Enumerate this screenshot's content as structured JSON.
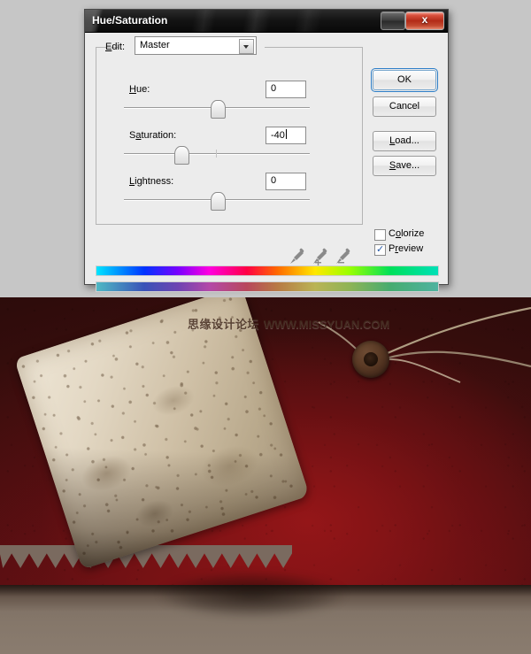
{
  "dialog": {
    "title": "Hue/Saturation",
    "window_buttons": [
      {
        "name": "minimize-button",
        "glyph": ""
      },
      {
        "name": "close-button",
        "glyph": "x"
      }
    ],
    "edit": {
      "label_pre": "",
      "label_accel": "E",
      "label_post": "dit:",
      "selected": "Master"
    },
    "sliders": [
      {
        "id": "hue",
        "label_pre": "",
        "label_accel": "H",
        "label_post": "ue:",
        "value": "0",
        "thumb_percent": 50,
        "caret": false
      },
      {
        "id": "saturation",
        "label_pre": "S",
        "label_accel": "a",
        "label_post": "turation:",
        "value": "-40",
        "thumb_percent": 31,
        "caret": true
      },
      {
        "id": "lightness",
        "label_pre": "",
        "label_accel": "L",
        "label_post": "ightness:",
        "value": "0",
        "thumb_percent": 50,
        "caret": false
      }
    ],
    "buttons": [
      {
        "id": "ok",
        "pre": "",
        "accel": "",
        "post": "OK",
        "primary": true
      },
      {
        "id": "cancel",
        "pre": "",
        "accel": "",
        "post": "Cancel",
        "primary": false
      },
      {
        "id": "load",
        "pre": "",
        "accel": "L",
        "post": "oad...",
        "primary": false
      },
      {
        "id": "save",
        "pre": "",
        "accel": "S",
        "post": "ave...",
        "primary": false
      }
    ],
    "checkboxes": [
      {
        "id": "colorize",
        "pre": "C",
        "accel": "o",
        "post": "lorize",
        "checked": false,
        "tick": "✓"
      },
      {
        "id": "preview",
        "pre": "P",
        "accel": "r",
        "post": "eview",
        "checked": true,
        "tick": "✓"
      }
    ],
    "eyedroppers": [
      {
        "name": "eyedropper-sample-icon",
        "modifier": ""
      },
      {
        "name": "eyedropper-add-icon",
        "modifier": "+"
      },
      {
        "name": "eyedropper-subtract-icon",
        "modifier": "−"
      }
    ],
    "spectrum_bars": [
      {
        "name": "spectrum-bar-original"
      },
      {
        "name": "spectrum-bar-adjusted"
      }
    ]
  },
  "photo": {
    "watermark_cn": "思缘设计论坛",
    "watermark_en": "WWW.MISSYUAN.COM"
  },
  "colors": {
    "dialog_bg": "#ececec",
    "titlebar": "#141414",
    "close_red": "#b32b18",
    "focus_blue": "#2e7fc8",
    "check_blue": "#2558a8",
    "desktop": "#c6c6c6",
    "photo_red": "#8e1418",
    "photo_floor": "#85776a",
    "tag_paper": "#e3d8c4",
    "eyelet": "#5a3a25"
  }
}
